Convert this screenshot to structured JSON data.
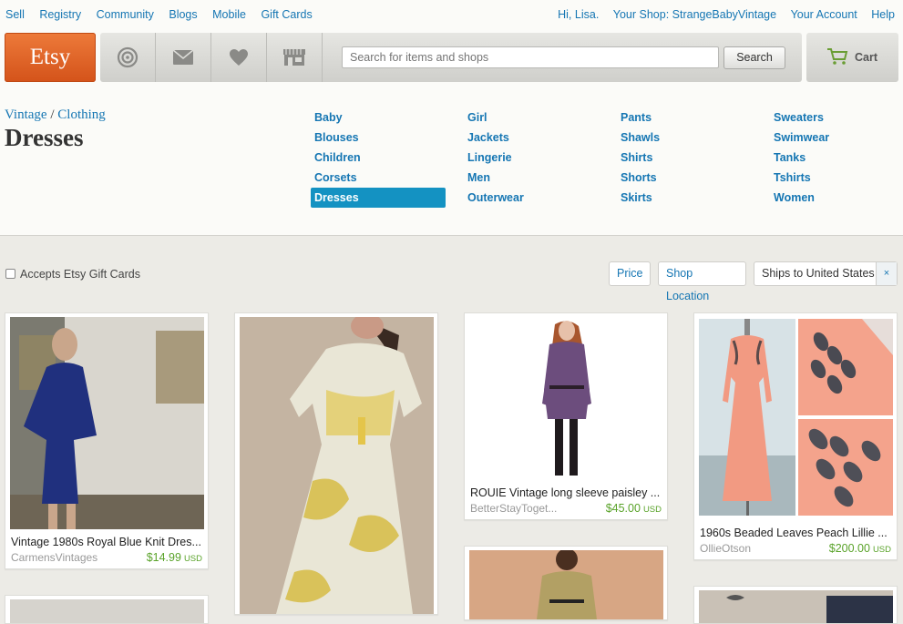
{
  "topnav": {
    "left": [
      "Sell",
      "Registry",
      "Community",
      "Blogs",
      "Mobile",
      "Gift Cards"
    ],
    "greeting": "Hi,",
    "user": "Lisa.",
    "shop_link": "Your Shop: StrangeBabyVintage",
    "account": "Your Account",
    "help": "Help"
  },
  "header": {
    "logo": "Etsy",
    "icons": [
      "activity-icon",
      "mail-icon",
      "heart-icon",
      "shop-icon"
    ],
    "search_placeholder": "Search for items and shops",
    "search_button": "Search",
    "cart_label": "Cart"
  },
  "category": {
    "crumb_1": "Vintage",
    "crumb_sep": "/",
    "crumb_2": "Clothing",
    "title": "Dresses",
    "columns": [
      [
        "Baby",
        "Blouses",
        "Children",
        "Corsets",
        "Dresses"
      ],
      [
        "Girl",
        "Jackets",
        "Lingerie",
        "Men",
        "Outerwear"
      ],
      [
        "Pants",
        "Shawls",
        "Shirts",
        "Shorts",
        "Skirts"
      ],
      [
        "Sweaters",
        "Swimwear",
        "Tanks",
        "Tshirts",
        "Women"
      ]
    ],
    "active": "Dresses"
  },
  "filters": {
    "gift_cards": "Accepts Etsy Gift Cards",
    "price": "Price",
    "location": "Shop Location",
    "ships": "Ships to United States",
    "remove": "×"
  },
  "listings": [
    {
      "title": "Vintage 1980s Royal Blue Knit Dres...",
      "shop": "CarmensVintages",
      "price": "$14.99",
      "currency": "USD"
    },
    {
      "title": "ROUIE Vintage long sleeve paisley ...",
      "shop": "BetterStayToget...",
      "price": "$45.00",
      "currency": "USD"
    },
    {
      "title": "1960s Beaded Leaves Peach Lillie ...",
      "shop": "OllieOtson",
      "price": "$200.00",
      "currency": "USD"
    }
  ],
  "colors": {
    "brand_orange": "#d4531a",
    "link_blue": "#1576b3",
    "active_blue": "#1492c2",
    "price_green": "#5aa32a"
  }
}
